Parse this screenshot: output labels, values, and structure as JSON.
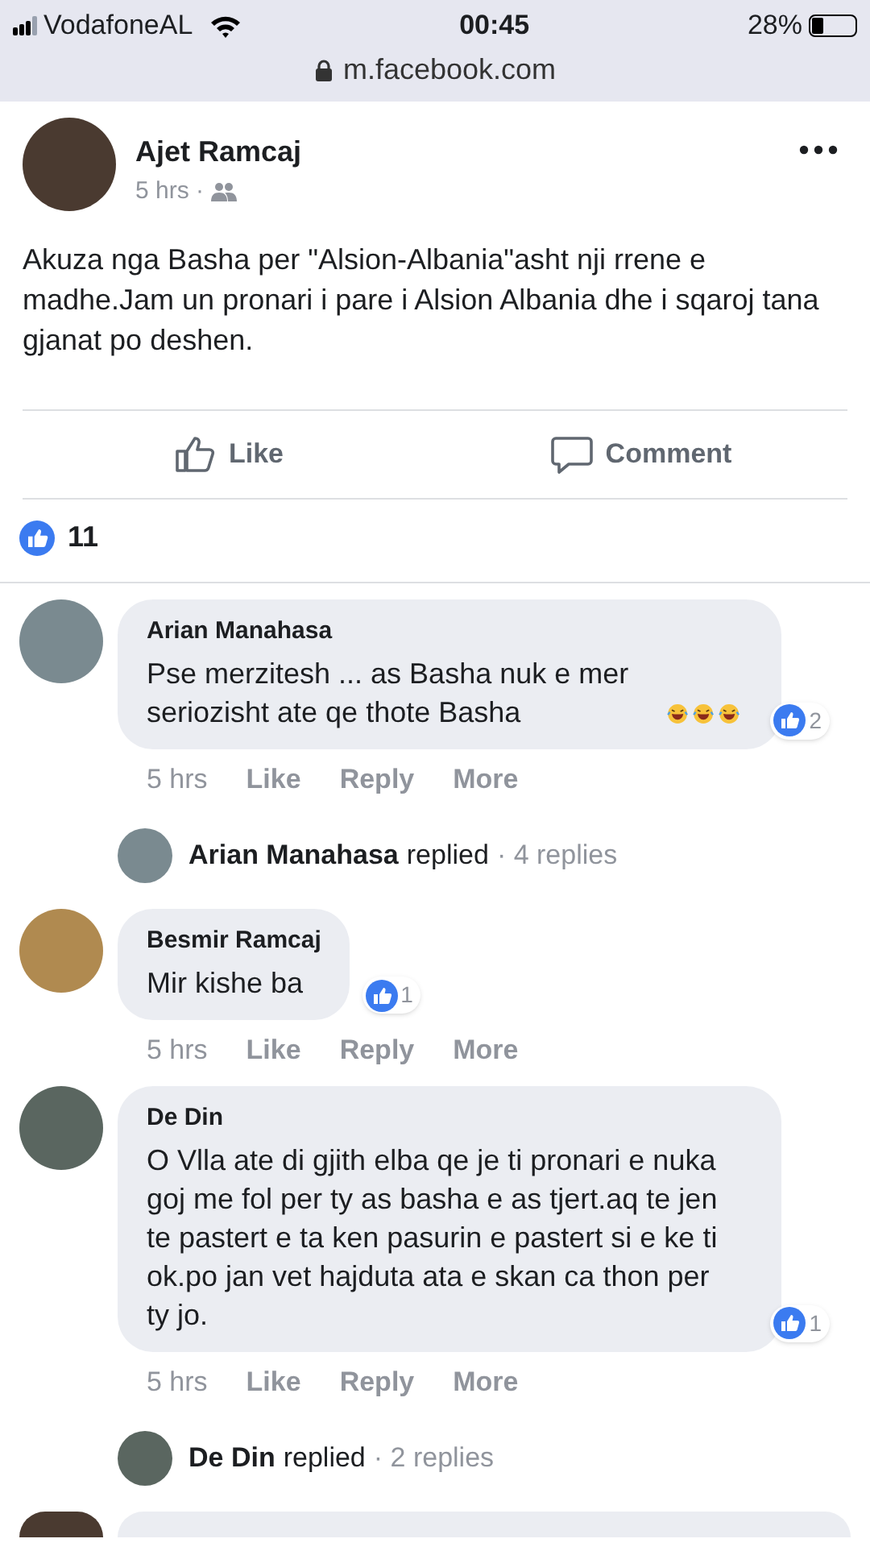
{
  "status_bar": {
    "carrier": "VodafoneAL",
    "time": "00:45",
    "battery": "28%"
  },
  "address_bar": {
    "url": "m.facebook.com"
  },
  "post": {
    "author": "Ajet Ramcaj",
    "time": "5 hrs ·",
    "text": "Akuza nga Basha per \"Alsion-Albania\"asht nji rrene e madhe.Jam un pronari i pare i Alsion Albania dhe i sqaroj tana gjanat po deshen.",
    "actions": [
      {
        "kind": "like",
        "label": "Like"
      },
      {
        "kind": "comment",
        "label": "Comment"
      }
    ],
    "reaction_count": "11"
  },
  "comments": [
    {
      "author": "Arian Manahasa",
      "text": "Pse merzitesh ... as Basha nuk e mer seriozisht ate qe thote Basha",
      "emojis": [
        {
          "kind": "laughing"
        },
        {
          "kind": "laughing"
        },
        {
          "kind": "laughing"
        }
      ],
      "likes": "2",
      "time": "5 hrs",
      "actions": [
        "Like",
        "Reply",
        "More"
      ],
      "replies": {
        "name": "Arian Manahasa",
        "verb": "replied",
        "count": "· 4 replies"
      }
    },
    {
      "author": "Besmir Ramcaj",
      "text": "Mir kishe ba",
      "likes": "1",
      "time": "5 hrs",
      "actions": [
        "Like",
        "Reply",
        "More"
      ]
    },
    {
      "author": "De Din",
      "text": "O Vlla ate di gjith elba qe je ti pronari e nuka goj me fol per ty as basha e as tjert.aq te jen te pastert e ta ken pasurin e pastert si e ke ti ok.po jan vet hajduta ata e skan ca thon per ty jo.",
      "likes": "1",
      "time": "5 hrs",
      "actions": [
        "Like",
        "Reply",
        "More"
      ],
      "replies": {
        "name": "De Din",
        "verb": "replied",
        "count": "· 2 replies"
      }
    }
  ]
}
